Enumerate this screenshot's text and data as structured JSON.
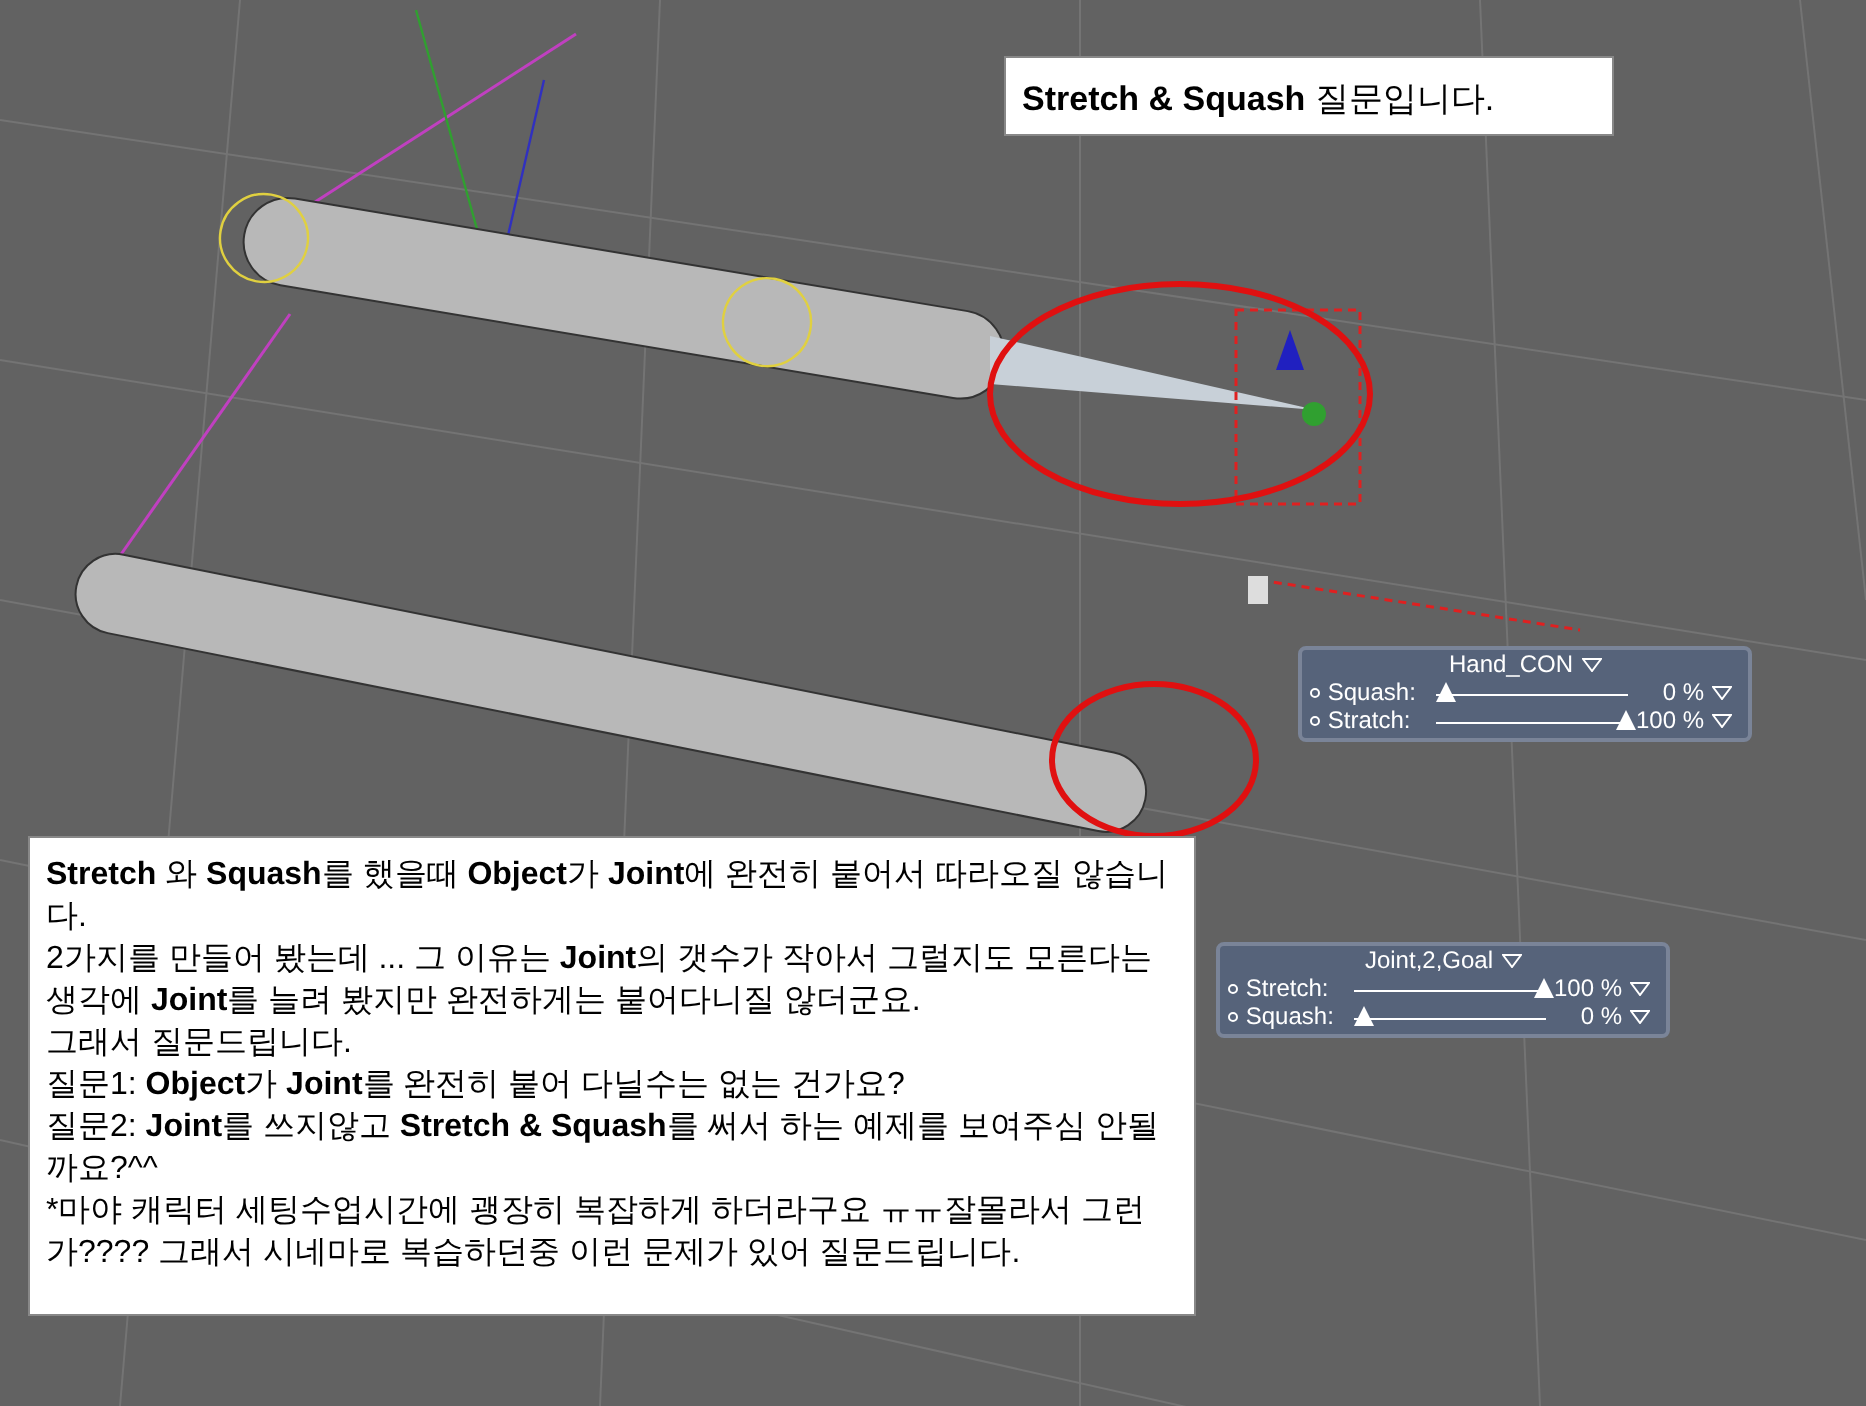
{
  "title_note": {
    "text": "**Stretch & Squash** 질문입니다."
  },
  "question_box": {
    "paragraphs": [
      {
        "kind": "rich",
        "text": "**Stretch** 와 **Squash**를 했을때 **Object**가 **Joint**에 완전히 붙어서 따라오질 않습니다."
      },
      {
        "kind": "rich",
        "text": "2가지를 만들어 봤는데 ... 그 이유는 **Joint**의 갯수가 작아서 그럴지도 모른다는 생각에 **Joint**를 늘려 봤지만 완전하게는 붙어다니질 않더군요."
      },
      {
        "kind": "rich",
        "text": "그래서 질문드립니다."
      },
      {
        "kind": "rich",
        "text": "질문1: **Object**가 **Joint**를 완전히 붙어 다닐수는 없는 건가요?"
      },
      {
        "kind": "rich",
        "text": "질문2: **Joint**를 쓰지않고 **Stretch & Squash**를 써서 하는 예제를 보여주심 안될까요?^^"
      },
      {
        "kind": "plain",
        "text": "*마야 캐릭터 세팅수업시간에 괭장히 복잡하게 하더라구요 ㅠㅠ잘몰라서 그런가???? 그래서 시네마로 복습하던중 이런 문제가 있어 질문드립니다."
      }
    ]
  },
  "control_panels": [
    {
      "title": "Hand_CON",
      "rows": [
        {
          "label": "Squash:",
          "level": 0,
          "reading": "0 %"
        },
        {
          "label": "Stratch:",
          "level": 1,
          "reading": "100 %"
        }
      ]
    },
    {
      "title": "Joint,2,Goal",
      "rows": [
        {
          "label": "Stretch:",
          "level": 1,
          "reading": "100 %"
        },
        {
          "label": "Squash:",
          "level": 0,
          "reading": "0 %"
        }
      ]
    }
  ]
}
